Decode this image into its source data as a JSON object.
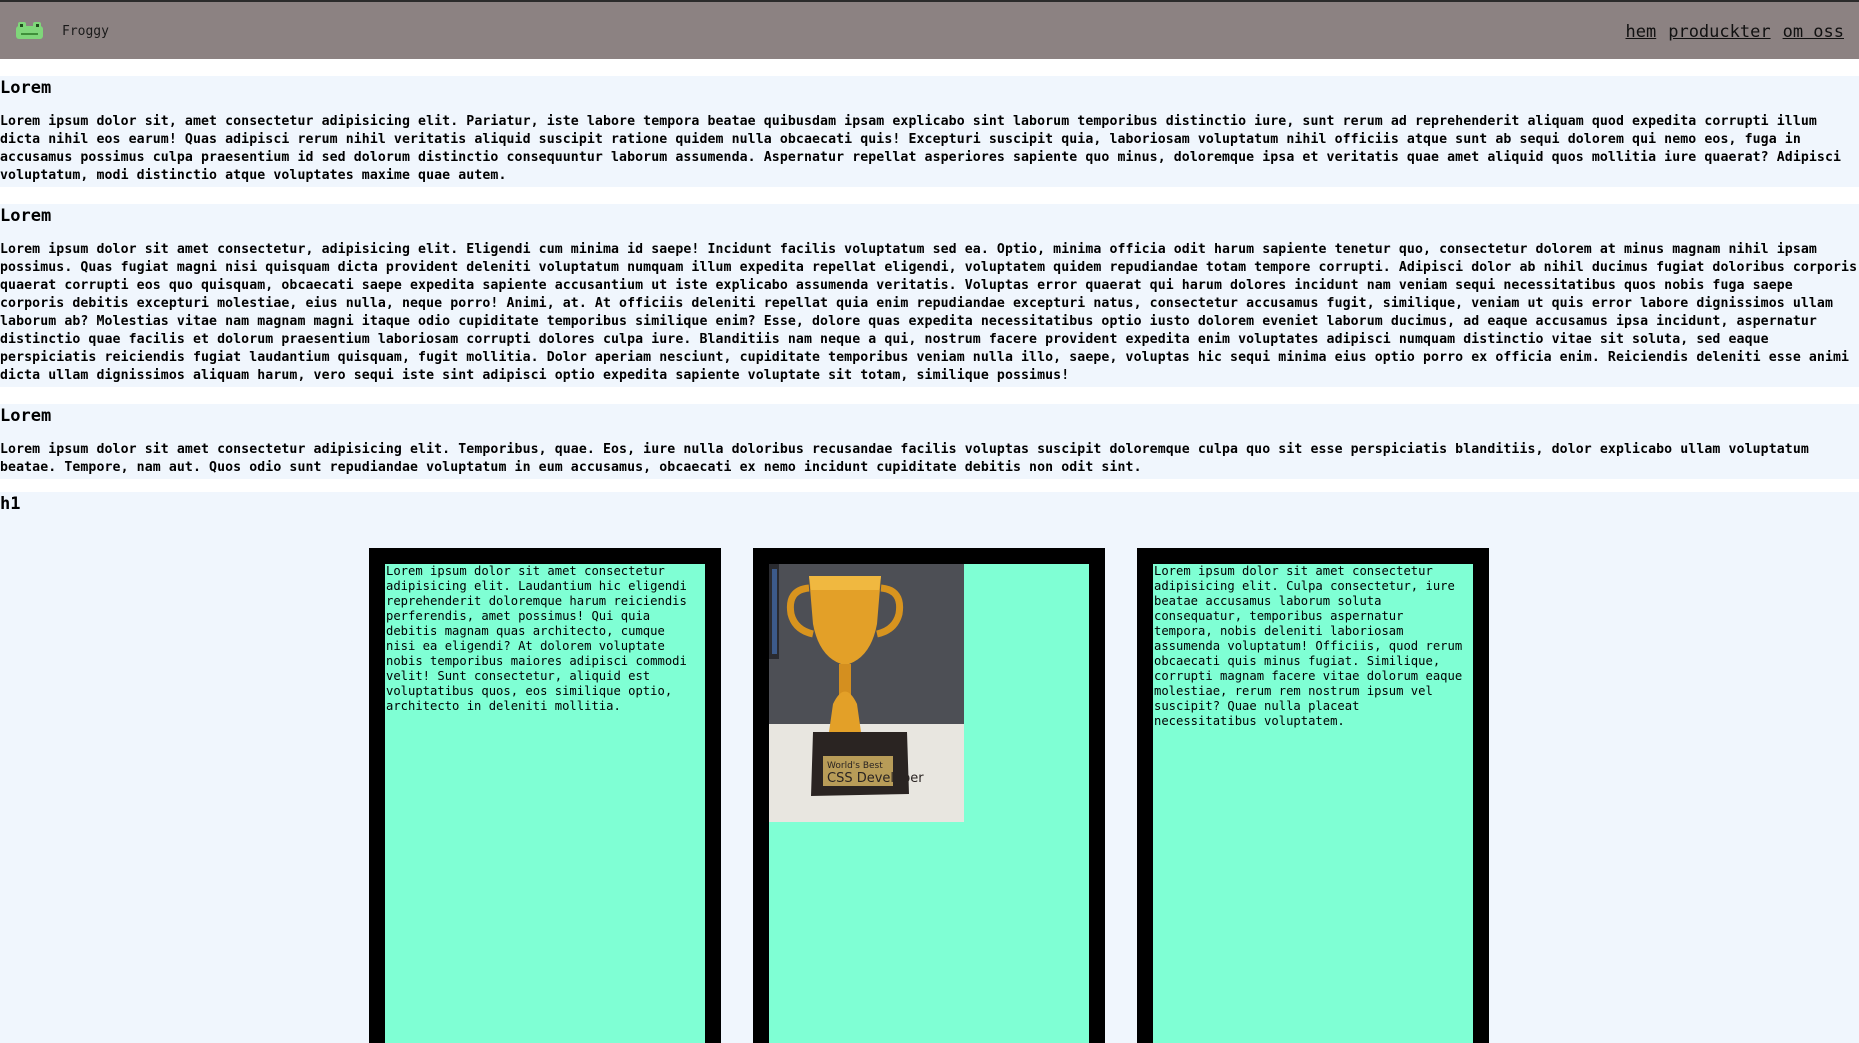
{
  "header": {
    "brand": "Froggy",
    "logo_icon": "frog-icon",
    "nav": [
      "hem",
      "produckter",
      "om oss"
    ]
  },
  "sections": [
    {
      "heading": "Lorem",
      "text": "Lorem ipsum dolor sit, amet consectetur adipisicing elit. Pariatur, iste labore tempora beatae quibusdam ipsam explicabo sint laborum temporibus distinctio iure, sunt rerum ad reprehenderit aliquam quod expedita corrupti illum dicta nihil eos earum! Quas adipisci rerum nihil veritatis aliquid suscipit ratione quidem nulla obcaecati quis! Excepturi suscipit quia, laboriosam voluptatum nihil officiis atque sunt ab sequi dolorem qui nemo eos, fuga in accusamus possimus culpa praesentium id sed dolorum distinctio consequuntur laborum assumenda. Aspernatur repellat asperiores sapiente quo minus, doloremque ipsa et veritatis quae amet aliquid quos mollitia iure quaerat? Adipisci voluptatum, modi distinctio atque voluptates maxime quae autem."
    },
    {
      "heading": "Lorem",
      "text": "Lorem ipsum dolor sit amet consectetur, adipisicing elit. Eligendi cum minima id saepe! Incidunt facilis voluptatum sed ea. Optio, minima officia odit harum sapiente tenetur quo, consectetur dolorem at minus magnam nihil ipsam possimus. Quas fugiat magni nisi quisquam dicta provident deleniti voluptatum numquam illum expedita repellat eligendi, voluptatem quidem repudiandae totam tempore corrupti. Adipisci dolor ab nihil ducimus fugiat doloribus corporis quaerat corrupti eos quo quisquam, obcaecati saepe expedita sapiente accusantium ut iste explicabo assumenda veritatis. Voluptas error quaerat qui harum dolores incidunt nam veniam sequi necessitatibus quos nobis fuga saepe corporis debitis excepturi molestiae, eius nulla, neque porro! Animi, at. At officiis deleniti repellat quia enim repudiandae excepturi natus, consectetur accusamus fugit, similique, veniam ut quis error labore dignissimos ullam laborum ab? Molestias vitae nam magnam magni itaque odio cupiditate temporibus similique enim? Esse, dolore quas expedita necessitatibus optio iusto dolorem eveniet laborum ducimus, ad eaque accusamus ipsa incidunt, aspernatur distinctio quae facilis et dolorum praesentium laboriosam corrupti dolores culpa iure. Blanditiis nam neque a qui, nostrum facere provident expedita enim voluptates adipisci numquam distinctio vitae sit soluta, sed eaque perspiciatis reiciendis fugiat laudantium quisquam, fugit mollitia. Dolor aperiam nesciunt, cupiditate temporibus veniam nulla illo, saepe, voluptas hic sequi minima eius optio porro ex officia enim. Reiciendis deleniti esse animi dicta ullam dignissimos aliquam harum, vero sequi iste sint adipisci optio expedita sapiente voluptate sit totam, similique possimus!"
    },
    {
      "heading": "Lorem",
      "text": "Lorem ipsum dolor sit amet consectetur adipisicing elit. Temporibus, quae. Eos, iure nulla doloribus recusandae facilis voluptas suscipit doloremque culpa quo sit esse perspiciatis blanditiis, dolor explicabo ullam voluptatum beatae. Tempore, nam aut. Quos odio sunt repudiandae voluptatum in eum accusamus, obcaecati ex nemo incidunt cupiditate debitis non odit sint."
    }
  ],
  "h1_title": "h1",
  "cards": [
    {
      "text": "Lorem ipsum dolor sit amet consectetur adipisicing elit. Laudantium hic eligendi reprehenderit doloremque harum reiciendis perferendis, amet possimus! Qui quia debitis magnam quas architecto, cumque nisi ea eligendi? At dolorem voluptate nobis temporibus maiores adipisci commodi velit! Sunt consectetur, aliquid est voluptatibus quos, eos similique optio, architecto in deleniti mollitia."
    },
    {
      "image": {
        "icon": "trophy-image",
        "plaque_line1": "World's Best",
        "plaque_line2": "CSS Developer"
      }
    },
    {
      "text": "Lorem ipsum dolor sit amet consectetur adipisicing elit. Culpa consectetur, iure beatae accusamus laborum soluta consequatur, temporibus aspernatur tempora, nobis deleniti laboriosam assumenda voluptatum! Officiis, quod rerum obcaecati quis minus fugiat. Similique, corrupti magnam facere vitae dolorum eaque molestiae, rerum rem nostrum ipsum vel suscipit? Quae nulla placeat necessitatibus voluptatem."
    }
  ],
  "colors": {
    "header_bg": "#8c8282",
    "section_bg": "#f0f6fd",
    "card_bg": "#7fffd4",
    "card_border": "#000000"
  }
}
